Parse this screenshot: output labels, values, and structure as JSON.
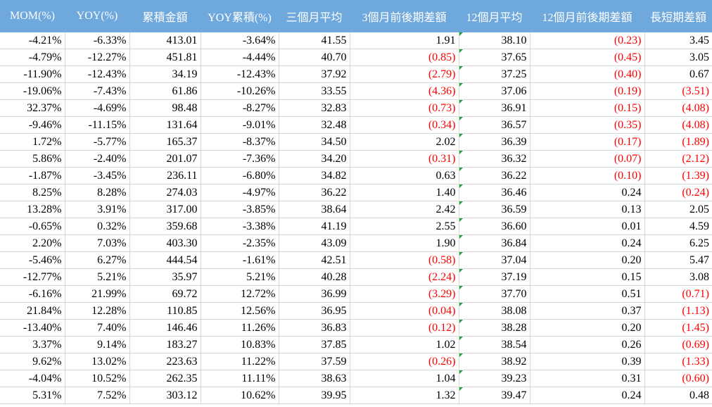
{
  "columns": [
    {
      "key": "mom",
      "label": "MOM(%)"
    },
    {
      "key": "yoy",
      "label": "YOY(%)"
    },
    {
      "key": "cum",
      "label": "累積金額"
    },
    {
      "key": "yoycum",
      "label": "YOY累積(%)"
    },
    {
      "key": "avg3",
      "label": "三個月平均"
    },
    {
      "key": "diff3",
      "label": "3個月前後期差額"
    },
    {
      "key": "avg12",
      "label": "12個月平均"
    },
    {
      "key": "diff12",
      "label": "12個月前後期差額"
    },
    {
      "key": "ls",
      "label": "長短期差額"
    }
  ],
  "colors": {
    "header_bg": "#6fa8dc",
    "header_text": "#ffffff",
    "negative": "#ff0000",
    "flag_marker": "#1a9e3a"
  },
  "rows": [
    [
      "-4.21%",
      "-6.33%",
      "413.01",
      "-3.64%",
      "41.55",
      "1.91",
      "38.10",
      "(0.23)",
      "3.45"
    ],
    [
      "-4.79%",
      "-12.27%",
      "451.81",
      "-4.44%",
      "40.70",
      "(0.85)",
      "37.65",
      "(0.45)",
      "3.05"
    ],
    [
      "-11.90%",
      "-12.43%",
      "34.19",
      "-12.43%",
      "37.92",
      "(2.79)",
      "37.25",
      "(0.40)",
      "0.67"
    ],
    [
      "-19.06%",
      "-7.43%",
      "61.86",
      "-10.26%",
      "33.55",
      "(4.36)",
      "37.06",
      "(0.19)",
      "(3.51)"
    ],
    [
      "32.37%",
      "-4.69%",
      "98.48",
      "-8.27%",
      "32.83",
      "(0.73)",
      "36.91",
      "(0.15)",
      "(4.08)"
    ],
    [
      "-9.46%",
      "-11.15%",
      "131.64",
      "-9.01%",
      "32.48",
      "(0.34)",
      "36.57",
      "(0.35)",
      "(4.08)"
    ],
    [
      "1.72%",
      "-5.77%",
      "165.37",
      "-8.37%",
      "34.50",
      "2.02",
      "36.39",
      "(0.17)",
      "(1.89)"
    ],
    [
      "5.86%",
      "-2.40%",
      "201.07",
      "-7.36%",
      "34.20",
      "(0.31)",
      "36.32",
      "(0.07)",
      "(2.12)"
    ],
    [
      "-1.87%",
      "-3.45%",
      "236.11",
      "-6.80%",
      "34.82",
      "0.63",
      "36.22",
      "(0.10)",
      "(1.39)"
    ],
    [
      "8.25%",
      "8.28%",
      "274.03",
      "-4.97%",
      "36.22",
      "1.40",
      "36.46",
      "0.24",
      "(0.24)"
    ],
    [
      "13.28%",
      "3.91%",
      "317.00",
      "-3.85%",
      "38.64",
      "2.42",
      "36.59",
      "0.13",
      "2.05"
    ],
    [
      "-0.65%",
      "0.32%",
      "359.68",
      "-3.38%",
      "41.19",
      "2.55",
      "36.60",
      "0.01",
      "4.59"
    ],
    [
      "2.20%",
      "7.03%",
      "403.30",
      "-2.35%",
      "43.09",
      "1.90",
      "36.84",
      "0.24",
      "6.25"
    ],
    [
      "-5.46%",
      "6.27%",
      "444.54",
      "-1.61%",
      "42.51",
      "(0.58)",
      "37.04",
      "0.20",
      "5.47"
    ],
    [
      "-12.77%",
      "5.21%",
      "35.97",
      "5.21%",
      "40.28",
      "(2.24)",
      "37.19",
      "0.15",
      "3.08"
    ],
    [
      "-6.16%",
      "21.99%",
      "69.72",
      "12.72%",
      "36.99",
      "(3.29)",
      "37.70",
      "0.51",
      "(0.71)"
    ],
    [
      "21.84%",
      "12.28%",
      "110.85",
      "12.56%",
      "36.95",
      "(0.04)",
      "38.08",
      "0.37",
      "(1.13)"
    ],
    [
      "-13.40%",
      "7.40%",
      "146.46",
      "11.26%",
      "36.83",
      "(0.12)",
      "38.28",
      "0.20",
      "(1.45)"
    ],
    [
      "3.37%",
      "9.14%",
      "183.27",
      "10.83%",
      "37.85",
      "1.02",
      "38.54",
      "0.26",
      "(0.69)"
    ],
    [
      "9.62%",
      "13.02%",
      "223.63",
      "11.22%",
      "37.59",
      "(0.26)",
      "38.92",
      "0.39",
      "(1.33)"
    ],
    [
      "-4.04%",
      "10.52%",
      "262.35",
      "11.11%",
      "38.63",
      "1.04",
      "39.23",
      "0.31",
      "(0.60)"
    ],
    [
      "5.31%",
      "7.52%",
      "303.12",
      "10.62%",
      "39.95",
      "1.32",
      "39.47",
      "0.24",
      "0.48"
    ]
  ]
}
